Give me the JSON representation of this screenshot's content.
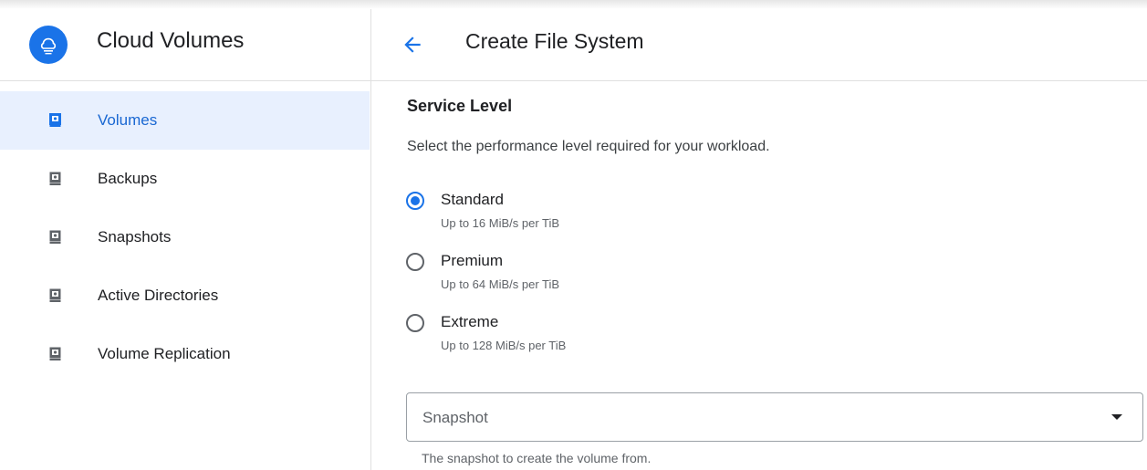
{
  "app": {
    "title": "Cloud Volumes",
    "logo_icon": "cloud-volumes-logo-icon",
    "accent_color": "#1a73e8"
  },
  "sidebar": {
    "items": [
      {
        "label": "Volumes",
        "icon": "volume-icon",
        "active": true
      },
      {
        "label": "Backups",
        "icon": "volume-icon",
        "active": false
      },
      {
        "label": "Snapshots",
        "icon": "volume-icon",
        "active": false
      },
      {
        "label": "Active Directories",
        "icon": "volume-icon",
        "active": false
      },
      {
        "label": "Volume Replication",
        "icon": "volume-icon",
        "active": false
      }
    ]
  },
  "header": {
    "back_icon": "arrow-back-icon",
    "title": "Create File System"
  },
  "service_level": {
    "title": "Service Level",
    "description": "Select the performance level required for your workload.",
    "options": [
      {
        "label": "Standard",
        "hint": "Up to 16 MiB/s per TiB",
        "selected": true
      },
      {
        "label": "Premium",
        "hint": "Up to 64 MiB/s per TiB",
        "selected": false
      },
      {
        "label": "Extreme",
        "hint": "Up to 128 MiB/s per TiB",
        "selected": false
      }
    ]
  },
  "snapshot": {
    "value": "Snapshot",
    "helper": "The snapshot to create the volume from.",
    "caret_icon": "dropdown-arrow-icon"
  }
}
